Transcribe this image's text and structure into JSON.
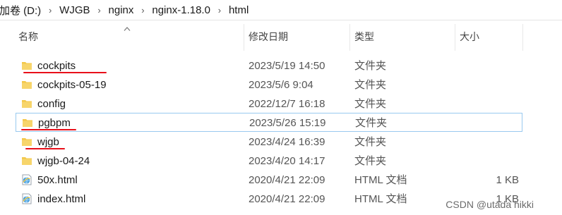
{
  "breadcrumb": {
    "items": [
      "加卷 (D:)",
      "WJGB",
      "nginx",
      "nginx-1.18.0",
      "html"
    ],
    "separator": "›"
  },
  "columns": {
    "name": "名称",
    "date": "修改日期",
    "type": "类型",
    "size": "大小"
  },
  "files": [
    {
      "name": "cockpits",
      "date": "2023/5/19 14:50",
      "type": "文件夹",
      "size": "",
      "icon": "folder-icon",
      "annotated": true
    },
    {
      "name": "cockpits-05-19",
      "date": "2023/5/6 9:04",
      "type": "文件夹",
      "size": "",
      "icon": "folder-icon",
      "annotated": false
    },
    {
      "name": "config",
      "date": "2022/12/7 16:18",
      "type": "文件夹",
      "size": "",
      "icon": "folder-icon",
      "annotated": false
    },
    {
      "name": "pgbpm",
      "date": "2023/5/26 15:19",
      "type": "文件夹",
      "size": "",
      "icon": "folder-icon",
      "annotated": true,
      "focused": true
    },
    {
      "name": "wjgb",
      "date": "2023/4/24 16:39",
      "type": "文件夹",
      "size": "",
      "icon": "folder-icon",
      "annotated": true
    },
    {
      "name": "wjgb-04-24",
      "date": "2023/4/20 14:17",
      "type": "文件夹",
      "size": "",
      "icon": "folder-icon",
      "annotated": false
    },
    {
      "name": "50x.html",
      "date": "2020/4/21 22:09",
      "type": "HTML 文档",
      "size": "1 KB",
      "icon": "html-file-icon",
      "annotated": false
    },
    {
      "name": "index.html",
      "date": "2020/4/21 22:09",
      "type": "HTML 文档",
      "size": "1 KB",
      "icon": "html-file-icon",
      "annotated": false
    }
  ],
  "watermark": "CSDN @utada hikki",
  "colors": {
    "folder": "#f3c84a",
    "annotation": "#e8101a",
    "focus_outline": "#99c9ef"
  }
}
